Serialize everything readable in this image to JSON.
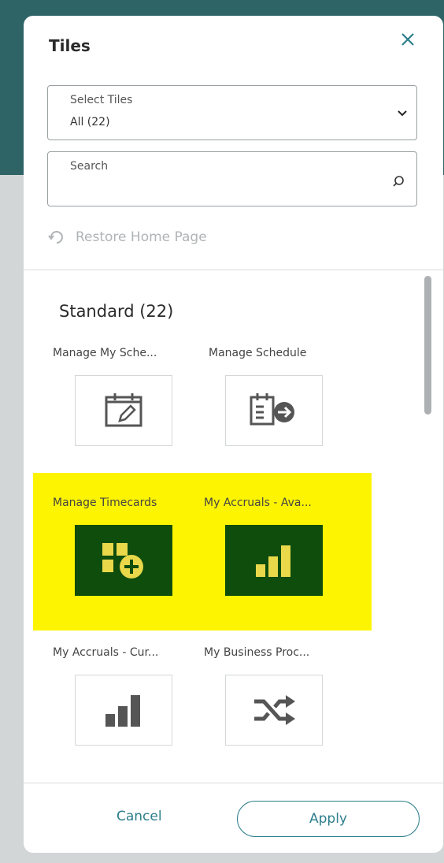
{
  "panel": {
    "title": "Tiles",
    "close_icon": "close-icon",
    "select_tiles": {
      "label": "Select Tiles",
      "value": "All (22)"
    },
    "search": {
      "label": "Search",
      "value": ""
    },
    "restore_label": "Restore Home Page"
  },
  "section": {
    "title": "Standard (22)"
  },
  "tiles": [
    {
      "label": "Manage My Sche...",
      "icon": "calendar-edit-icon",
      "highlighted": false
    },
    {
      "label": "Manage Schedule",
      "icon": "schedule-arrow-icon",
      "highlighted": false
    },
    {
      "label": "Manage Timecards",
      "icon": "timecards-add-icon",
      "highlighted": true
    },
    {
      "label": "My Accruals - Ava...",
      "icon": "bar-chart-icon",
      "highlighted": true
    },
    {
      "label": "My Accruals - Cur...",
      "icon": "bar-chart-icon",
      "highlighted": false
    },
    {
      "label": "My Business Proc...",
      "icon": "shuffle-icon",
      "highlighted": false
    }
  ],
  "footer": {
    "cancel_label": "Cancel",
    "apply_label": "Apply"
  },
  "colors": {
    "accent": "#2d7e8c",
    "highlight": "#fdf402",
    "tile_dark": "#0f4d0d",
    "header_teal": "#2f6467"
  }
}
